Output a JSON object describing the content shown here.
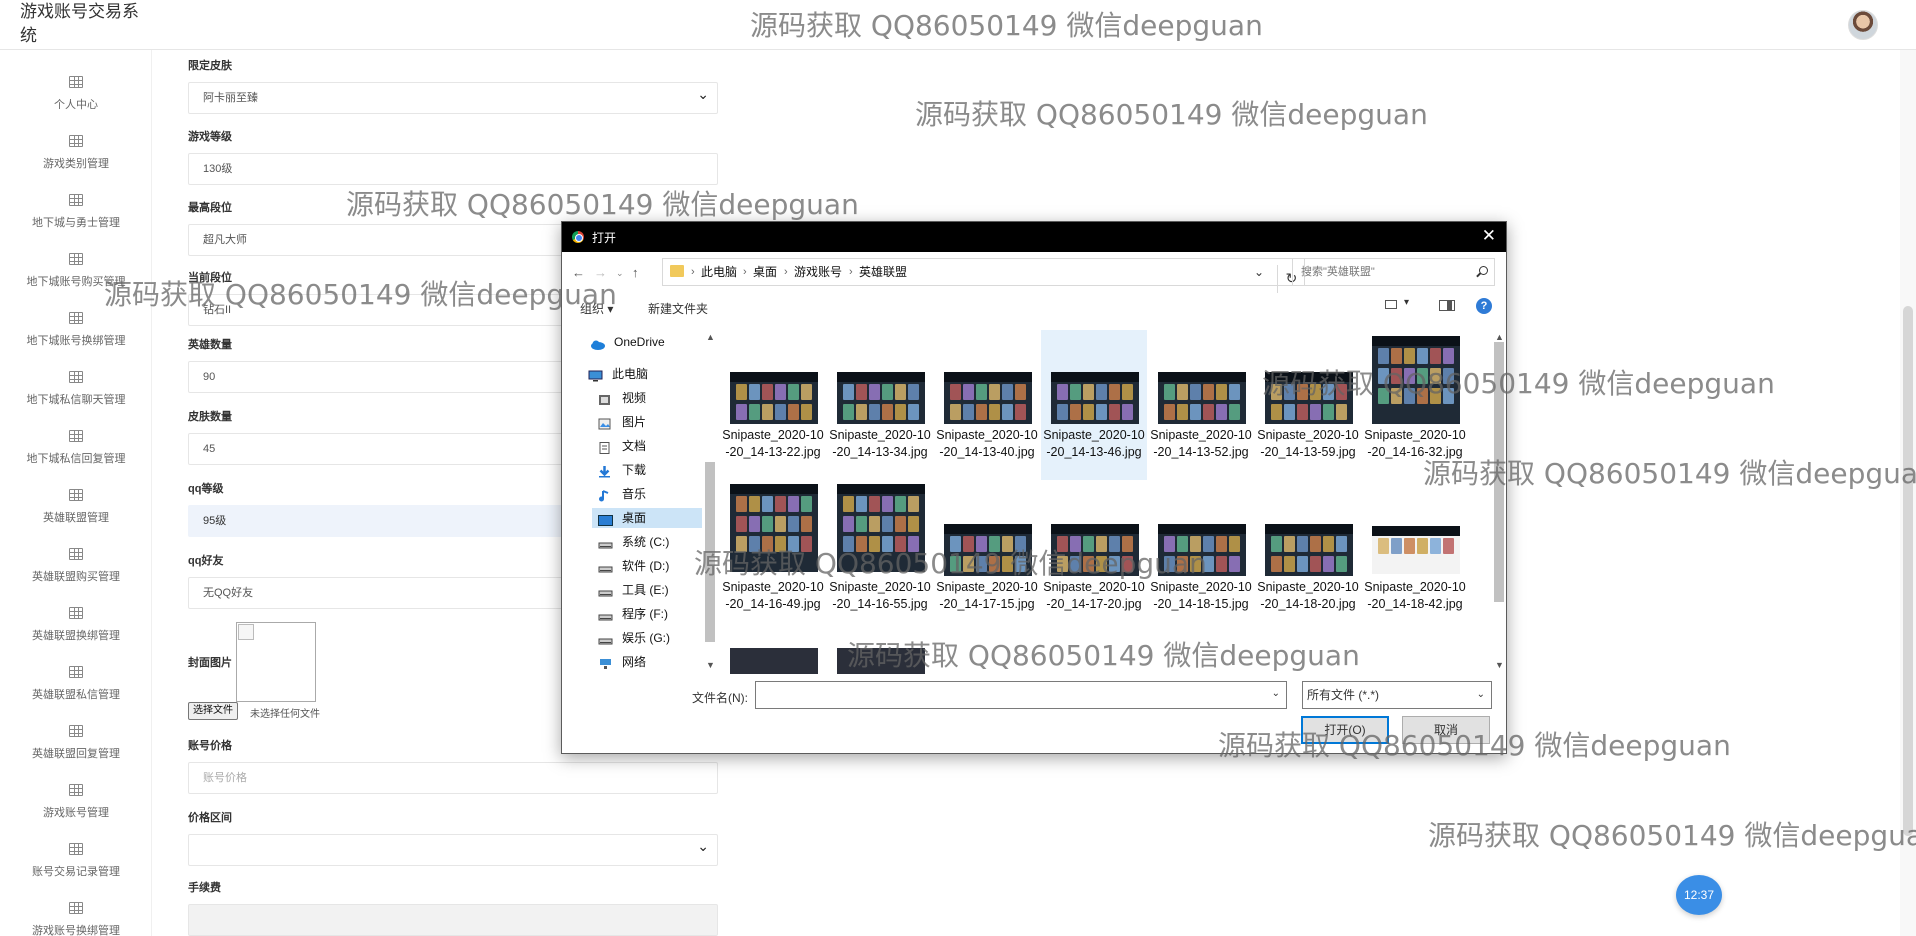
{
  "app": {
    "title": "游戏账号交易系统"
  },
  "sidebar": {
    "items": [
      {
        "label": "个人中心"
      },
      {
        "label": "游戏类别管理"
      },
      {
        "label": "地下城与勇士管理"
      },
      {
        "label": "地下城账号购买管理"
      },
      {
        "label": "地下城账号换绑管理"
      },
      {
        "label": "地下城私信聊天管理"
      },
      {
        "label": "地下城私信回复管理"
      },
      {
        "label": "英雄联盟管理"
      },
      {
        "label": "英雄联盟购买管理"
      },
      {
        "label": "英雄联盟换绑管理"
      },
      {
        "label": "英雄联盟私信管理"
      },
      {
        "label": "英雄联盟回复管理"
      },
      {
        "label": "游戏账号管理"
      },
      {
        "label": "账号交易记录管理"
      },
      {
        "label": "游戏账号换绑管理"
      }
    ]
  },
  "form": {
    "limited_skin": {
      "label": "限定皮肤",
      "value": "阿卡丽至臻"
    },
    "game_level": {
      "label": "游戏等级",
      "value": "130级"
    },
    "highest_rank": {
      "label": "最高段位",
      "value": "超凡大师"
    },
    "current_rank": {
      "label": "当前段位",
      "value": "钻石II"
    },
    "hero_count": {
      "label": "英雄数量",
      "value": "90"
    },
    "skin_count": {
      "label": "皮肤数量",
      "value": "45"
    },
    "qq_level": {
      "label": "qq等级",
      "value": "95级"
    },
    "qq_friends": {
      "label": "qq好友",
      "value": "无QQ好友"
    },
    "cover": {
      "label": "封面图片",
      "choose_file": "选择文件",
      "no_file": "未选择任何文件"
    },
    "price": {
      "label": "账号价格",
      "placeholder": "账号价格"
    },
    "price_range": {
      "label": "价格区间",
      "value": ""
    },
    "fee": {
      "label": "手续费",
      "value": ""
    }
  },
  "clock": "12:37",
  "dialog": {
    "title": "打开",
    "breadcrumb": [
      "此电脑",
      "桌面",
      "游戏账号",
      "英雄联盟"
    ],
    "search_placeholder": "搜索\"英雄联盟\"",
    "toolbar": {
      "organize": "组织 ▾",
      "new_folder": "新建文件夹"
    },
    "nav": [
      {
        "label": "OneDrive",
        "icon": "cloud-icon"
      },
      {
        "label": "此电脑",
        "icon": "computer-icon"
      },
      {
        "label": "视频",
        "icon": "video-icon"
      },
      {
        "label": "图片",
        "icon": "picture-icon"
      },
      {
        "label": "文档",
        "icon": "document-icon"
      },
      {
        "label": "下载",
        "icon": "download-icon"
      },
      {
        "label": "音乐",
        "icon": "music-icon"
      },
      {
        "label": "桌面",
        "icon": "desktop-icon",
        "selected": true
      },
      {
        "label": "系统 (C:)",
        "icon": "drive-icon"
      },
      {
        "label": "软件 (D:)",
        "icon": "drive-icon"
      },
      {
        "label": "工具 (E:)",
        "icon": "drive-icon"
      },
      {
        "label": "程序 (F:)",
        "icon": "drive-icon"
      },
      {
        "label": "娱乐 (G:)",
        "icon": "drive-icon"
      },
      {
        "label": "网络",
        "icon": "network-icon"
      }
    ],
    "files": [
      "Snipaste_2020-10-20_14-13-22.jpg",
      "Snipaste_2020-10-20_14-13-34.jpg",
      "Snipaste_2020-10-20_14-13-40.jpg",
      "Snipaste_2020-10-20_14-13-46.jpg",
      "Snipaste_2020-10-20_14-13-52.jpg",
      "Snipaste_2020-10-20_14-13-59.jpg",
      "Snipaste_2020-10-20_14-16-32.jpg",
      "Snipaste_2020-10-20_14-16-49.jpg",
      "Snipaste_2020-10-20_14-16-55.jpg",
      "Snipaste_2020-10-20_14-17-15.jpg",
      "Snipaste_2020-10-20_14-17-20.jpg",
      "Snipaste_2020-10-20_14-18-15.jpg",
      "Snipaste_2020-10-20_14-18-20.jpg",
      "Snipaste_2020-10-20_14-18-42.jpg"
    ],
    "filename_label": "文件名(N):",
    "filename_value": "",
    "filetype": "所有文件 (*.*)",
    "open_button": "打开(O)",
    "cancel_button": "取消"
  },
  "watermark": "源码获取 QQ86050149 微信deepguan"
}
